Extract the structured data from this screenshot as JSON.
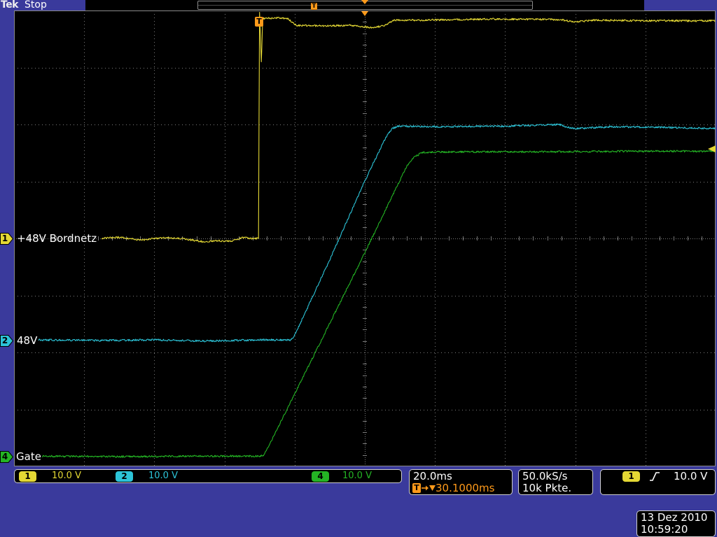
{
  "header": {
    "brand": "Tek",
    "status": "Stop"
  },
  "markers": {
    "trigger": "T"
  },
  "channels": [
    {
      "id": "1",
      "scale": "10.0 V",
      "color": "#e4d834"
    },
    {
      "id": "2",
      "scale": "10.0 V",
      "color": "#2cc4d8"
    },
    {
      "id": "4",
      "scale": "10.0 V",
      "color": "#24b424"
    }
  ],
  "horizontal": {
    "scale": "20.0ms",
    "delay": "30.1000ms",
    "delay_icon": "trigger-to-expansion-arrow-icon"
  },
  "acquisition": {
    "sample_rate": "50.0kS/s",
    "record_length": "10k Pkte."
  },
  "trigger": {
    "source": "1",
    "slope_icon": "rising-edge-icon",
    "level": "10.0 V"
  },
  "timestamp": {
    "date": "13 Dez 2010",
    "time": "10:59:20"
  },
  "colors": {
    "background": "#3a3a9c",
    "screen": "#000000",
    "accent": "#ff9a1a",
    "grid": "#7a7a7a",
    "text": "#ffffff"
  },
  "chart_data": {
    "type": "line",
    "grid": true,
    "series": [
      {
        "name": "+48V Bordnetz",
        "channel": "1",
        "points": [
          [
            -44.9,
            0.0
          ],
          [
            -40.0,
            0.2
          ],
          [
            -33.9,
            -0.3
          ],
          [
            -28.0,
            0.1
          ],
          [
            -22.0,
            0.0
          ],
          [
            -16.0,
            -0.6
          ],
          [
            -12.0,
            -0.4
          ],
          [
            -8.0,
            -0.5
          ],
          [
            -5.0,
            0.1
          ],
          [
            -0.2,
            0.0
          ],
          [
            0.1,
            39.8
          ],
          [
            0.6,
            30.9
          ],
          [
            1.0,
            38.6
          ],
          [
            6.0,
            38.7
          ],
          [
            8.4,
            38.5
          ],
          [
            10.5,
            37.4
          ],
          [
            18.0,
            37.3
          ],
          [
            26.0,
            37.4
          ],
          [
            32.0,
            37.0
          ],
          [
            35.5,
            37.3
          ],
          [
            38.5,
            38.3
          ],
          [
            46.0,
            38.3
          ],
          [
            66.0,
            38.5
          ],
          [
            86.0,
            38.4
          ],
          [
            89.5,
            38.0
          ],
          [
            96.0,
            38.3
          ],
          [
            110.0,
            38.2
          ],
          [
            130.0,
            38.2
          ]
        ]
      },
      {
        "name": "48V",
        "channel": "2",
        "points": [
          [
            -62.9,
            0.1
          ],
          [
            -45.0,
            0.0
          ],
          [
            -30.0,
            0.1
          ],
          [
            -15.0,
            -0.1
          ],
          [
            0.0,
            0.1
          ],
          [
            9.0,
            0.1
          ],
          [
            9.8,
            0.5
          ],
          [
            20.0,
            14.0
          ],
          [
            30.1,
            28.0
          ],
          [
            36.4,
            36.0
          ],
          [
            38.0,
            37.2
          ],
          [
            39.5,
            37.6
          ],
          [
            50.0,
            37.5
          ],
          [
            70.0,
            37.6
          ],
          [
            85.5,
            37.9
          ],
          [
            88.5,
            37.3
          ],
          [
            91.0,
            37.2
          ],
          [
            100.0,
            37.5
          ],
          [
            115.0,
            37.4
          ],
          [
            130.0,
            37.2
          ]
        ]
      },
      {
        "name": "Gate",
        "channel": "4",
        "points": [
          [
            -61.9,
            0.1
          ],
          [
            -40.0,
            0.0
          ],
          [
            -20.0,
            0.1
          ],
          [
            0.0,
            0.1
          ],
          [
            1.2,
            0.2
          ],
          [
            2.0,
            1.0
          ],
          [
            16.0,
            18.3
          ],
          [
            30.1,
            35.8
          ],
          [
            42.0,
            50.9
          ],
          [
            44.0,
            52.5
          ],
          [
            46.5,
            53.4
          ],
          [
            55.0,
            53.5
          ],
          [
            80.0,
            53.5
          ],
          [
            105.0,
            53.6
          ],
          [
            130.0,
            53.6
          ]
        ]
      }
    ]
  }
}
